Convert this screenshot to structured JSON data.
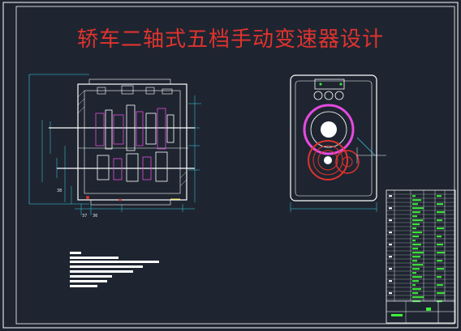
{
  "drawing": {
    "title": "轿车二轴式五档手动变速器设计",
    "dimension_labels": {
      "front_left": "38",
      "front_bottom_a": "37",
      "front_bottom_b": "36"
    },
    "colors": {
      "background": "#1e2530",
      "frame": "#ffffff",
      "title": "#e0332e",
      "dimension": "#3fd0f0",
      "part_magenta": "#e64ae0",
      "part_red": "#e0332e",
      "part_green": "#3ef03a",
      "part_yellow": "#f0e03a"
    }
  }
}
